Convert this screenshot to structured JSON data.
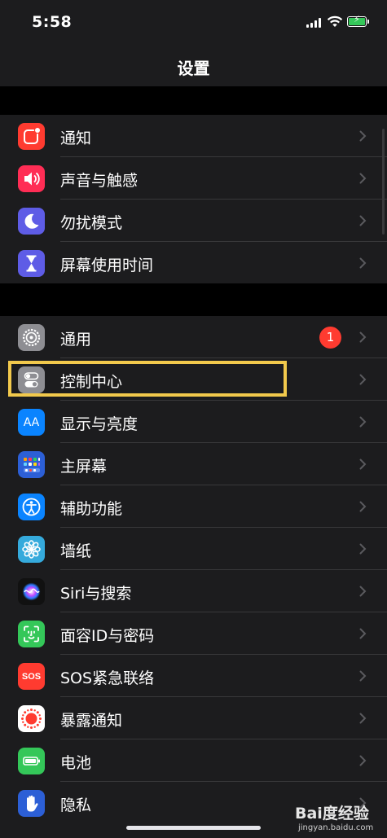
{
  "status": {
    "time": "5:58"
  },
  "nav": {
    "title": "设置"
  },
  "group1": [
    {
      "label": "通知",
      "icon": "notifications-icon",
      "color": "#ff3b30"
    },
    {
      "label": "声音与触感",
      "icon": "sound-icon",
      "color": "#ff2d55"
    },
    {
      "label": "勿扰模式",
      "icon": "moon-icon",
      "color": "#5e5ce6"
    },
    {
      "label": "屏幕使用时间",
      "icon": "hourglass-icon",
      "color": "#5e5ce6"
    }
  ],
  "group2": [
    {
      "label": "通用",
      "icon": "gear-icon",
      "color": "#8e8e93",
      "badge": "1"
    },
    {
      "label": "控制中心",
      "icon": "toggles-icon",
      "color": "#8e8e93"
    },
    {
      "label": "显示与亮度",
      "icon": "display-icon",
      "color": "#0a84ff"
    },
    {
      "label": "主屏幕",
      "icon": "home-screen-icon",
      "color": "#2c5fd6"
    },
    {
      "label": "辅助功能",
      "icon": "accessibility-icon",
      "color": "#0a84ff"
    },
    {
      "label": "墙纸",
      "icon": "wallpaper-icon",
      "color": "#35aadc"
    },
    {
      "label": "Siri与搜索",
      "icon": "siri-icon",
      "color": "#1c1c1e"
    },
    {
      "label": "面容ID与密码",
      "icon": "face-id-icon",
      "color": "#34c759"
    },
    {
      "label": "SOS紧急联络",
      "icon": "sos-icon",
      "color": "#ff3b30"
    },
    {
      "label": "暴露通知",
      "icon": "exposure-icon",
      "color": "#ffffff"
    },
    {
      "label": "电池",
      "icon": "battery-icon",
      "color": "#34c759"
    },
    {
      "label": "隐私",
      "icon": "hand-icon",
      "color": "#2c5fd6"
    }
  ],
  "icon_text": {
    "sos": "SOS",
    "display": "AA"
  },
  "watermark": {
    "logo": "Bai度经验",
    "url": "jingyan.baidu.com"
  }
}
